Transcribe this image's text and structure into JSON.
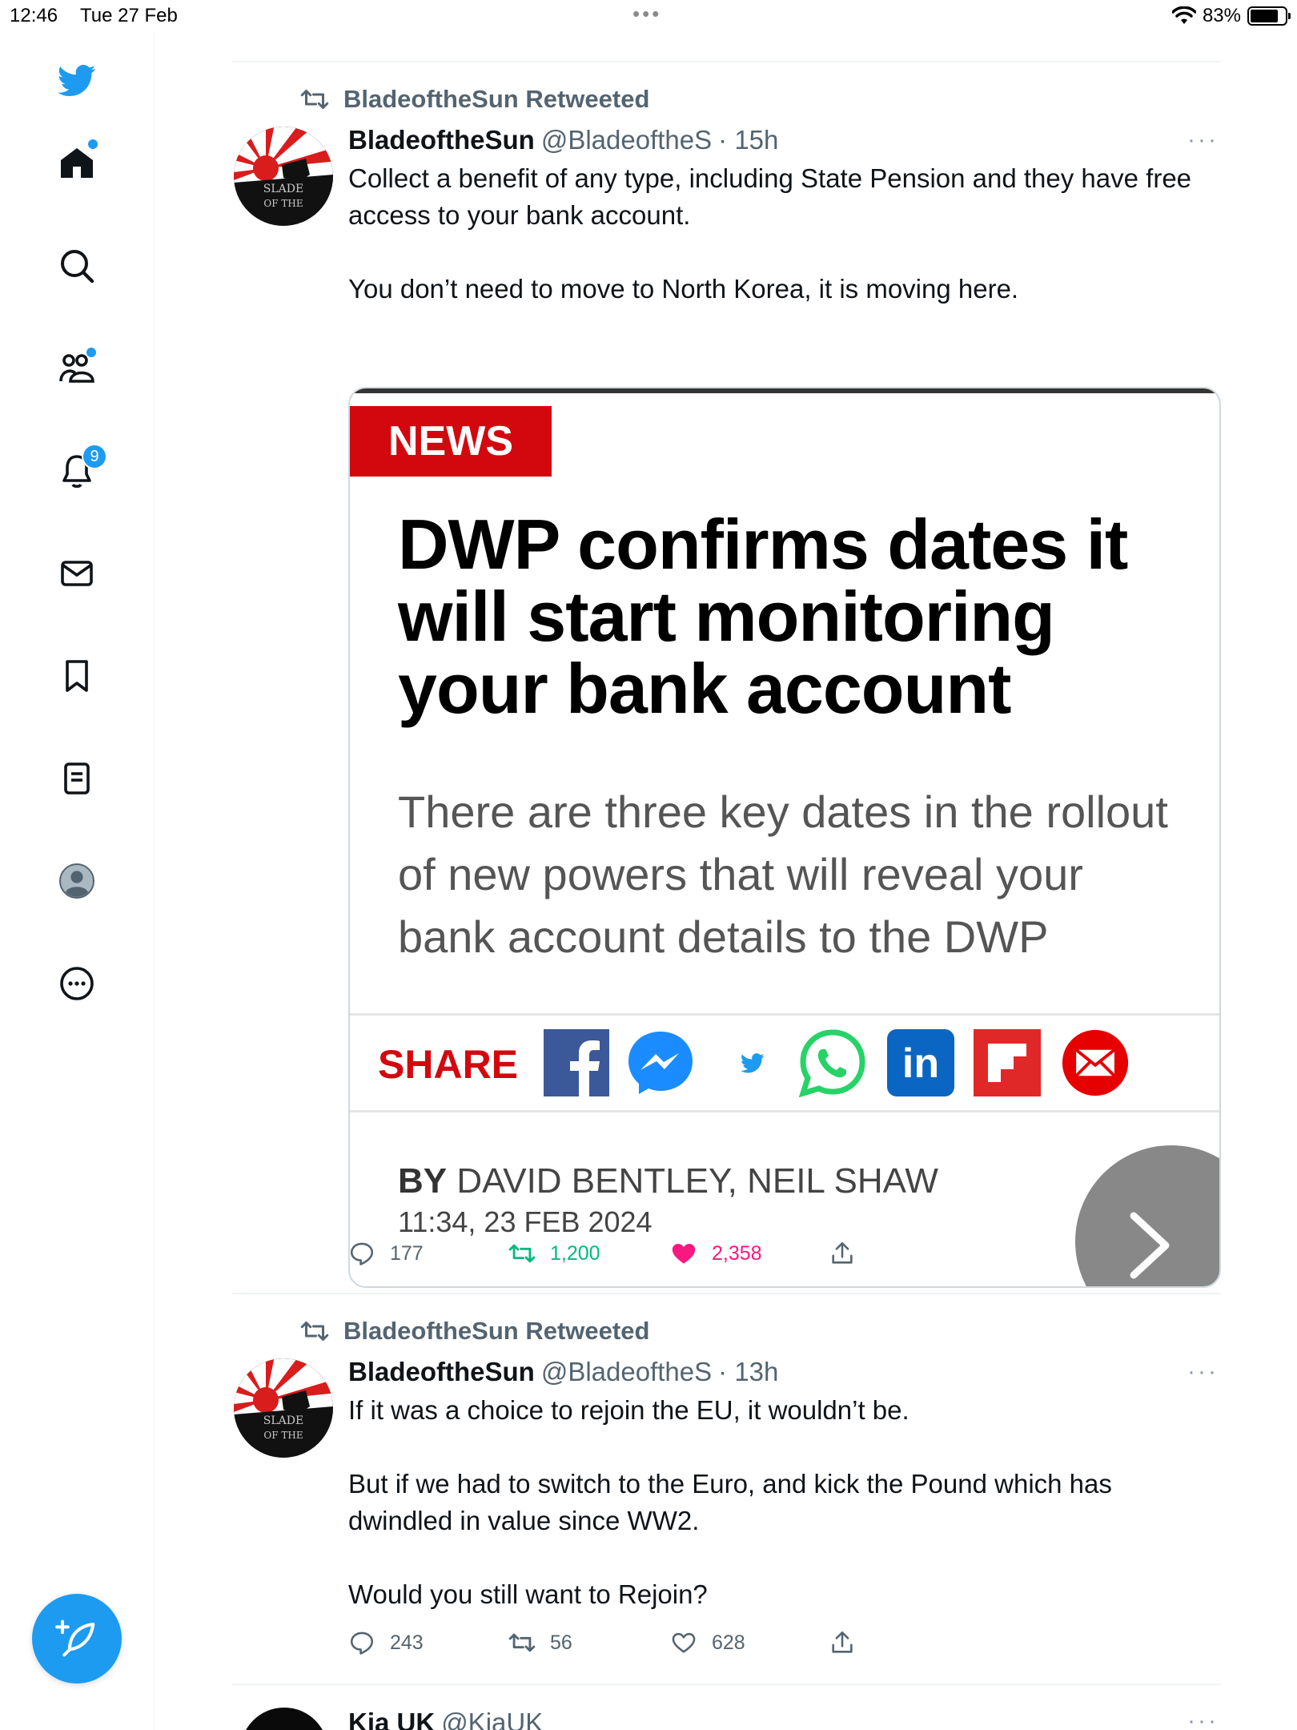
{
  "status_bar": {
    "time": "12:46",
    "date": "Tue 27 Feb",
    "battery": "83%",
    "multitask_dots": "•••"
  },
  "sidebar": {
    "items": [
      {
        "icon": "twitter-logo-icon"
      },
      {
        "icon": "home-icon",
        "has_dot": true
      },
      {
        "icon": "search-icon"
      },
      {
        "icon": "communities-icon",
        "has_dot": true
      },
      {
        "icon": "bell-icon",
        "badge": "9"
      },
      {
        "icon": "mail-icon"
      },
      {
        "icon": "bookmark-icon"
      },
      {
        "icon": "lists-icon"
      },
      {
        "icon": "profile-avatar-icon"
      },
      {
        "icon": "more-circle-icon"
      }
    ],
    "compose_icon": "compose-tweet-icon",
    "accent": "#1d9bf0"
  },
  "tweets": [
    {
      "retweeted_by": "BladeoftheSun Retweeted",
      "name": "BladeoftheSun",
      "handle": "@BladeoftheS",
      "time": "· 15h",
      "more": "···",
      "text": [
        "Collect a benefit of any type, including State Pension and they have free access to your bank account.",
        "You don’t need to move to North Korea, it is moving here."
      ],
      "card": {
        "tag": "NEWS",
        "headline": "DWP confirms dates it will start monitoring your bank account",
        "standfirst": "There are three key dates in the rollout of new powers that will reveal your bank account details to the DWP",
        "share_label": "SHARE",
        "share_icons": [
          "facebook-icon",
          "messenger-icon",
          "twitter-small-icon",
          "whatsapp-icon",
          "linkedin-icon",
          "flipboard-icon",
          "email-icon"
        ],
        "byline_prefix": "BY",
        "byline_authors": "DAVID BENTLEY, NEIL SHAW",
        "byline_date": "11:34, 23 FEB 2024",
        "tag_color": "#d3080f"
      },
      "actions": {
        "replies": "177",
        "retweets": "1,200",
        "likes": "2,358",
        "retweeted": true,
        "liked": true
      }
    },
    {
      "retweeted_by": "BladeoftheSun Retweeted",
      "name": "BladeoftheSun",
      "handle": "@BladeoftheS",
      "time": "· 13h",
      "more": "···",
      "text": [
        "If it was a choice to rejoin the EU, it wouldn’t be.",
        "But if we had to switch to the Euro, and kick the Pound which has dwindled in value since WW2.",
        "Would you still want to Rejoin?"
      ],
      "actions": {
        "replies": "243",
        "retweets": "56",
        "likes": "628",
        "retweeted": false,
        "liked": false
      }
    },
    {
      "name": "Kia UK",
      "handle": "@KiaUK",
      "more": "···"
    }
  ]
}
